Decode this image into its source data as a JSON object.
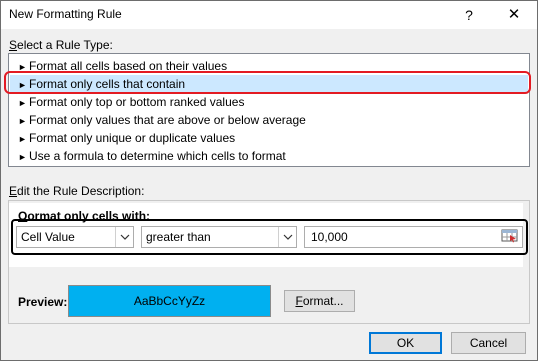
{
  "window": {
    "title": "New Formatting Rule",
    "help": "?",
    "close": "✕"
  },
  "rule_type": {
    "label": "Select a Rule Type:",
    "items": [
      "Format all cells based on their values",
      "Format only cells that contain",
      "Format only top or bottom ranked values",
      "Format only values that are above or below average",
      "Format only unique or duplicate values",
      "Use a formula to determine which cells to format"
    ],
    "selected_index": 1
  },
  "description": {
    "label": "Edit the Rule Description:",
    "format_only_label": "Format only cells with:",
    "condition_type": "Cell Value",
    "operator": "greater than",
    "value": "10,000"
  },
  "preview": {
    "label": "Preview:",
    "sample": "AaBbCcYyZz",
    "format_button": "Format...",
    "fill_color": "#00b0f0"
  },
  "footer": {
    "ok": "OK",
    "cancel": "Cancel"
  },
  "colors": {
    "highlight_outline": "#e31b23",
    "selected_row": "#cce8ff"
  }
}
